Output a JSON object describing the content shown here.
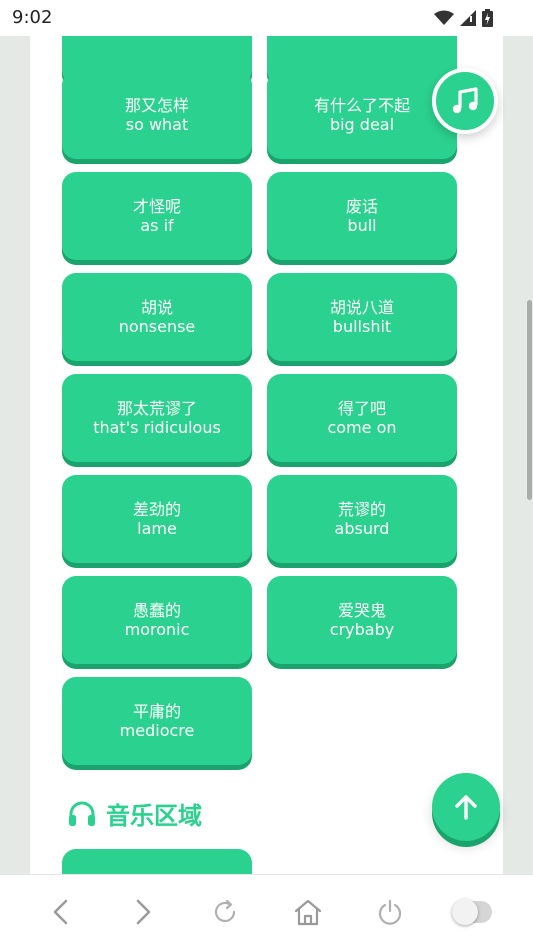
{
  "status": {
    "time": "9:02"
  },
  "phrases": [
    {
      "zh": "",
      "en": ""
    },
    {
      "zh": "",
      "en": ""
    },
    {
      "zh": "那又怎样",
      "en": "so what"
    },
    {
      "zh": "有什么了不起",
      "en": "big deal"
    },
    {
      "zh": "才怪呢",
      "en": "as if"
    },
    {
      "zh": "废话",
      "en": "bull"
    },
    {
      "zh": "胡说",
      "en": "nonsense"
    },
    {
      "zh": "胡说八道",
      "en": "bullshit"
    },
    {
      "zh": "那太荒谬了",
      "en": "that's ridiculous"
    },
    {
      "zh": "得了吧",
      "en": "come on"
    },
    {
      "zh": "差劲的",
      "en": "lame"
    },
    {
      "zh": "荒谬的",
      "en": "absurd"
    },
    {
      "zh": "愚蠢的",
      "en": "moronic"
    },
    {
      "zh": "爱哭鬼",
      "en": "crybaby"
    },
    {
      "zh": "平庸的",
      "en": "mediocre"
    }
  ],
  "section": {
    "title": "音乐区域",
    "icon": "headphones-icon"
  },
  "fabs": {
    "music": "music-note-icon",
    "scroll_top": "arrow-up-icon"
  },
  "colors": {
    "accent": "#2bd18e",
    "accent_shadow": "#1aa36c"
  },
  "bottom_nav": [
    "back-icon",
    "forward-icon",
    "reload-icon",
    "home-icon",
    "power-icon",
    "toggle-switch"
  ]
}
